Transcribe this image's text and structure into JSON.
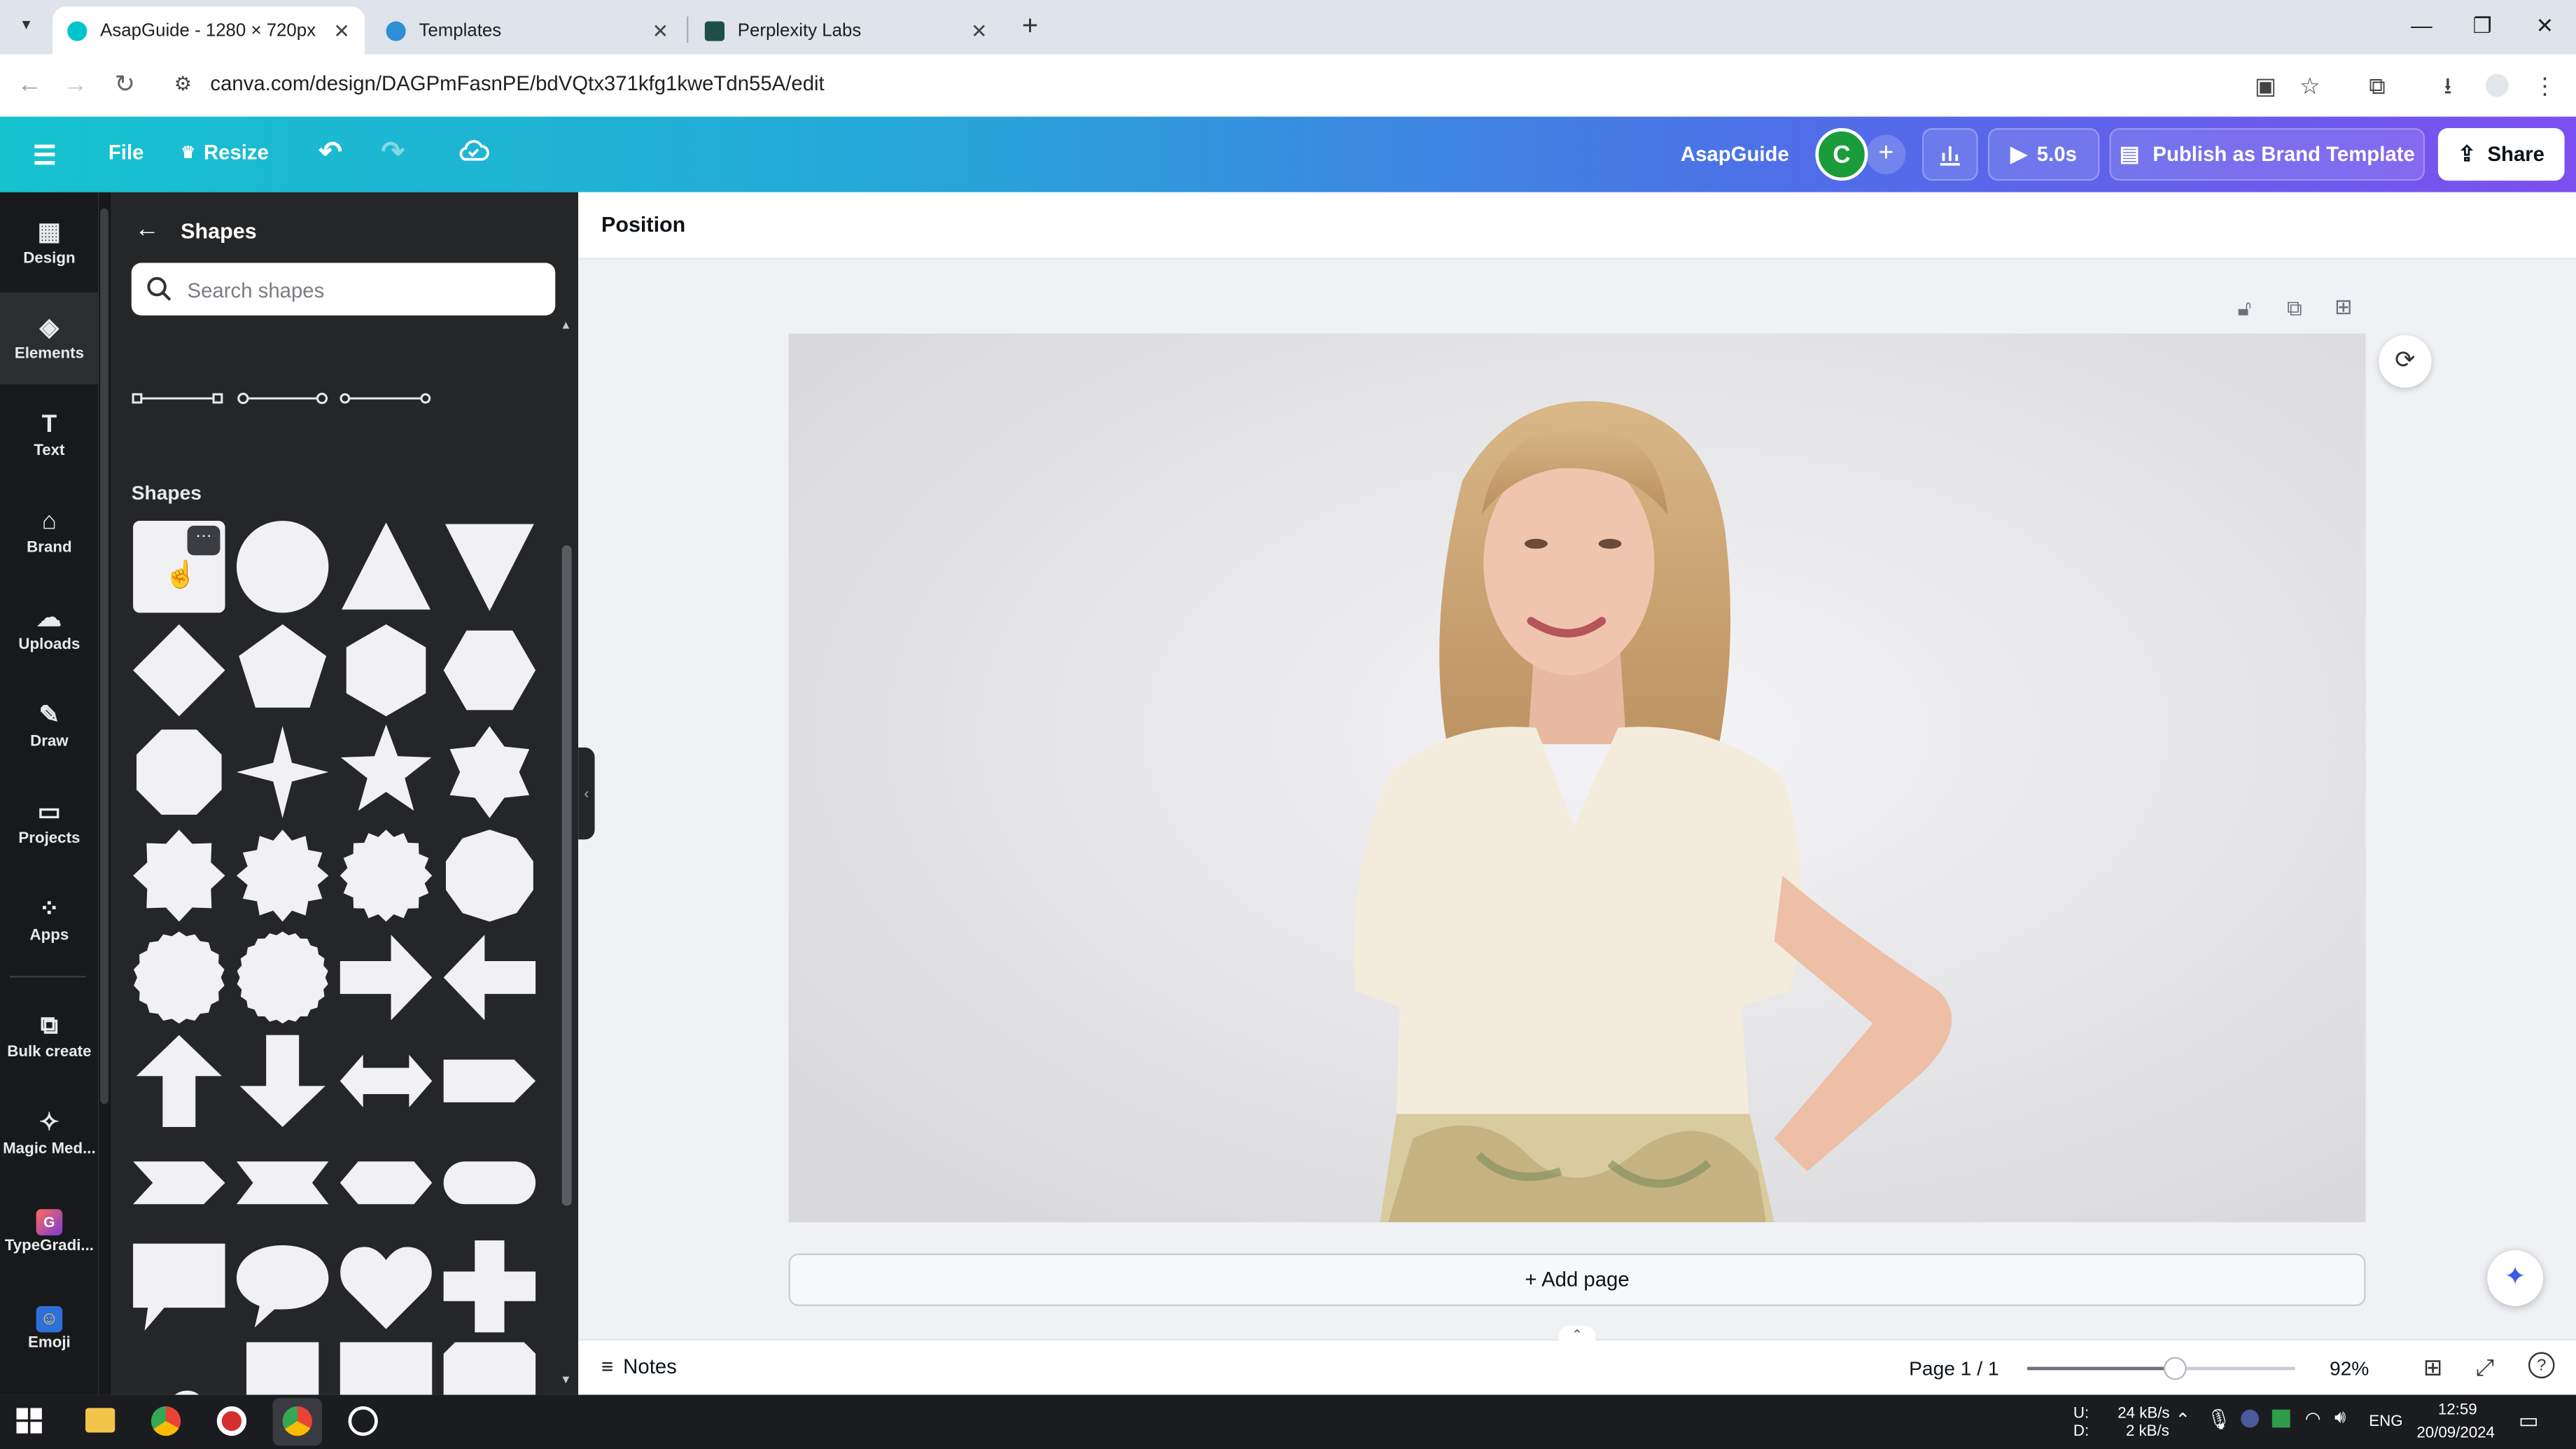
{
  "browser": {
    "tabs": [
      {
        "title": "AsapGuide - 1280 × 720px",
        "active": true
      },
      {
        "title": "Templates",
        "active": false
      },
      {
        "title": "Perplexity Labs",
        "active": false
      }
    ],
    "url": "canva.com/design/DAGPmFasnPE/bdVQtx371kfg1kweTdn55A/edit"
  },
  "header": {
    "file_label": "File",
    "resize_label": "Resize",
    "design_name": "AsapGuide",
    "avatar_letter": "C",
    "play_duration": "5.0s",
    "publish_label": "Publish as Brand Template",
    "share_label": "Share"
  },
  "sidebar": {
    "items": [
      {
        "label": "Design",
        "icon": "design-icon"
      },
      {
        "label": "Elements",
        "icon": "elements-icon",
        "active": true
      },
      {
        "label": "Text",
        "icon": "text-icon"
      },
      {
        "label": "Brand",
        "icon": "brand-icon"
      },
      {
        "label": "Uploads",
        "icon": "uploads-icon"
      },
      {
        "label": "Draw",
        "icon": "draw-icon"
      },
      {
        "label": "Projects",
        "icon": "projects-icon"
      },
      {
        "label": "Apps",
        "icon": "apps-icon"
      },
      {
        "label": "Bulk create",
        "icon": "bulk-create-icon"
      },
      {
        "label": "Magic Med...",
        "icon": "magic-media-icon"
      },
      {
        "label": "TypeGradi...",
        "icon": "typegradient-app-icon"
      },
      {
        "label": "Emoji",
        "icon": "emoji-app-icon"
      }
    ]
  },
  "panel": {
    "title": "Shapes",
    "search_placeholder": "Search shapes",
    "shapes_heading": "Shapes",
    "shape_names": [
      "square",
      "circle",
      "triangle",
      "inverted-triangle",
      "diamond",
      "pentagon",
      "hexagon-vertical",
      "hexagon",
      "octagon",
      "four-point-star",
      "five-point-star",
      "six-point-star",
      "eight-point-burst",
      "twelve-point-burst",
      "sixteen-point-burst",
      "decagon",
      "scalloped-circle",
      "scalloped-circle-fine",
      "right-arrow",
      "left-arrow",
      "up-arrow",
      "down-arrow",
      "double-arrow",
      "pentagon-arrow",
      "chevron",
      "ribbon",
      "hexagon-wide",
      "pill",
      "speech-bubble-rect",
      "speech-bubble-oval",
      "heart",
      "cross",
      "cloud",
      "rectangle-tall",
      "rectangle-cut",
      "rectangle-rounded-tab"
    ]
  },
  "editor": {
    "toolbar_label": "Position",
    "add_page_label": "+ Add page",
    "notes_label": "Notes",
    "page_indicator": "Page 1 / 1",
    "zoom": "92%",
    "zoom_fraction": 0.55
  },
  "taskbar": {
    "upload_label": "U:",
    "download_label": "D:",
    "upload_speed": "24 kB/s",
    "download_speed": "2 kB/s",
    "language": "ENG",
    "time": "12:59",
    "date": "20/09/2024"
  },
  "colors": {
    "canva_header_start": "#16c3cf",
    "canva_header_end": "#7c4ff0",
    "sidebar_bg": "#18191b",
    "panel_bg": "#252627",
    "avatar_green": "#1a9c3a"
  }
}
